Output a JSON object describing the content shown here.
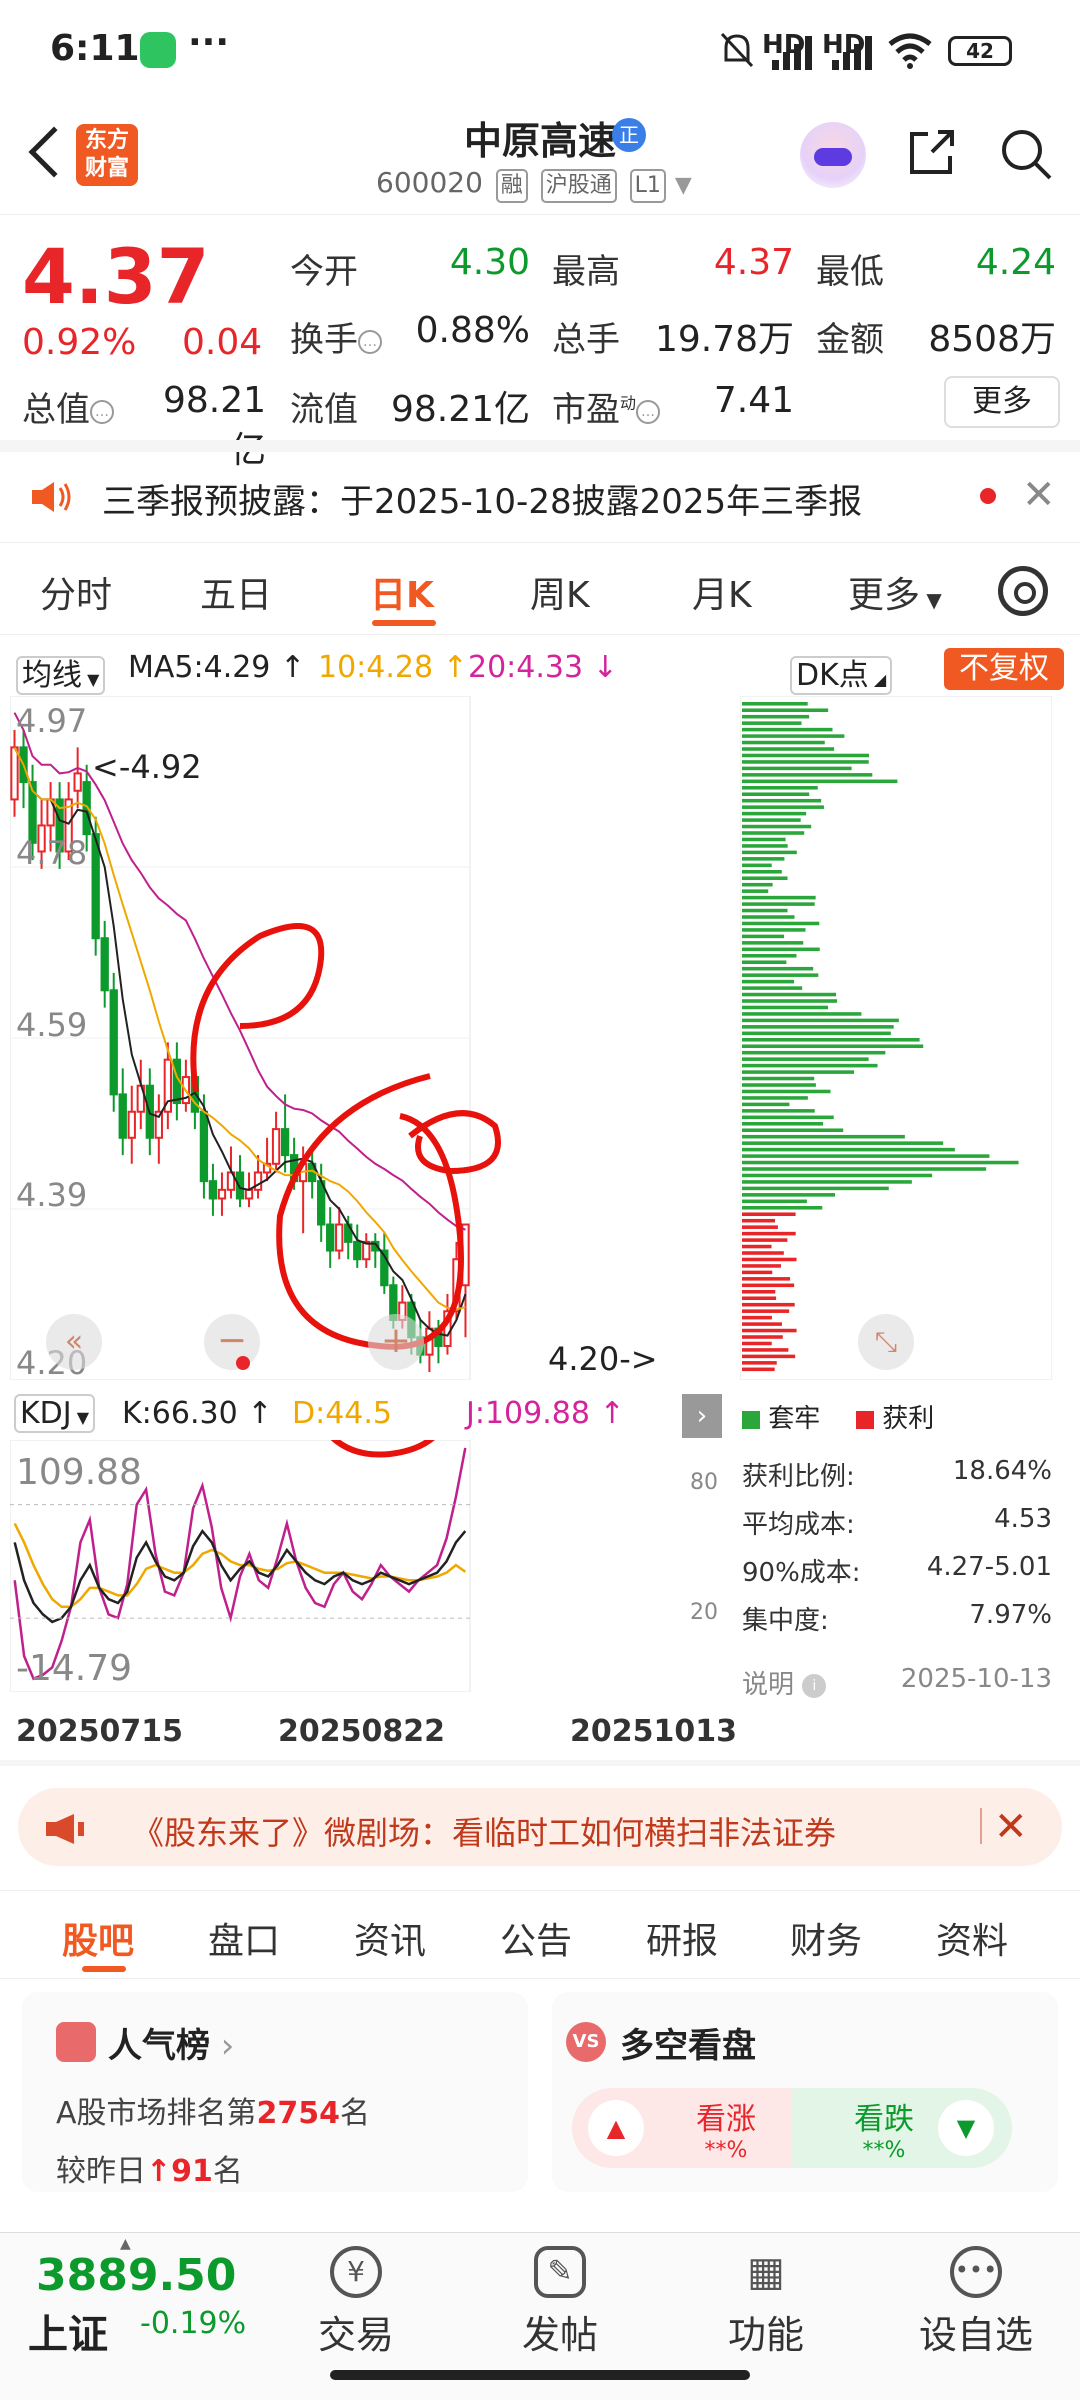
{
  "status_bar": {
    "time": "6:11",
    "dots": "···",
    "signal1": "HD",
    "signal2": "HD",
    "battery": "42"
  },
  "header": {
    "back_icon": "chevron-left-icon",
    "brand": "东方财富",
    "stock_name": "中原高速",
    "badge": "正",
    "code": "600020",
    "tags": [
      "融",
      "沪股通",
      "L1"
    ]
  },
  "quote": {
    "price": "4.37",
    "change_pct": "0.92%",
    "change_amt": "0.04",
    "open_label": "今开",
    "open": "4.30",
    "high_label": "最高",
    "high": "4.37",
    "low_label": "最低",
    "low": "4.24",
    "turnover_label": "换手",
    "turnover": "0.88%",
    "volume_label": "总手",
    "volume": "19.78万",
    "amount_label": "金额",
    "amount": "8508万",
    "mktcap_label": "总值",
    "mktcap": "98.21亿",
    "float_label": "流值",
    "float": "98.21亿",
    "pe_label": "市盈",
    "pe_sup": "动",
    "pe": "7.41",
    "more": "更多"
  },
  "notice": {
    "text": "三季报预披露：于2025-10-28披露2025年三季报"
  },
  "tabs": [
    "分时",
    "五日",
    "日K",
    "周K",
    "月K",
    "更多"
  ],
  "chart_header": {
    "ma_select": "均线",
    "ma5": "MA5:4.29",
    "ma10": "10:4.28",
    "ma20": "20:4.33",
    "dk": "DK点",
    "adjust": "不复权"
  },
  "price_axis": [
    "4.97",
    "4.78",
    "4.59",
    "4.39",
    "4.20"
  ],
  "annotations": {
    "high_mark": "<-4.92",
    "low_mark": "4.20->"
  },
  "kdj": {
    "select": "KDJ",
    "k": "K:66.30",
    "d": "D:44.5",
    "j": "J:109.88",
    "top": "109.88",
    "bottom": "-14.79",
    "lv80": "80",
    "lv20": "20"
  },
  "dates": [
    "20250715",
    "20250822",
    "20251013"
  ],
  "cost_dist": {
    "legend_loss": "套牢",
    "legend_profit": "获利",
    "profit_ratio_label": "获利比例:",
    "profit_ratio": "18.64%",
    "avg_cost_label": "平均成本:",
    "avg_cost": "4.53",
    "cost90_label": "90%成本:",
    "cost90": "4.27-5.01",
    "concentration_label": "集中度:",
    "concentration": "7.97%",
    "note": "说明",
    "date": "2025-10-13"
  },
  "promo": {
    "text": "《股东来了》微剧场：看临时工如何横扫非法证券"
  },
  "bottom_tabs": [
    "股吧",
    "盘口",
    "资讯",
    "公告",
    "研报",
    "财务",
    "资料"
  ],
  "cards": {
    "popularity": {
      "title": "人气榜",
      "rank_prefix": "A股市场排名第",
      "rank": "2754",
      "rank_suffix": "名",
      "delta_prefix": "较昨日",
      "delta": "91",
      "delta_suffix": "名"
    },
    "sentiment": {
      "title": "多空看盘",
      "up": "看涨",
      "up_pct": "**%",
      "down": "看跌",
      "down_pct": "**%"
    }
  },
  "bottom_nav": {
    "index_value": "3889.50",
    "index_name": "上证",
    "index_change": "-0.19%",
    "items": [
      "交易",
      "发帖",
      "功能",
      "设自选"
    ]
  },
  "chart_data": {
    "type": "candlestick",
    "candles": [
      [
        4.86,
        4.92,
        4.94,
        4.84
      ],
      [
        4.92,
        4.88,
        4.94,
        4.85
      ],
      [
        4.88,
        4.81,
        4.9,
        4.79
      ],
      [
        4.8,
        4.83,
        4.86,
        4.78
      ],
      [
        4.83,
        4.86,
        4.88,
        4.8
      ],
      [
        4.86,
        4.8,
        4.88,
        4.78
      ],
      [
        4.8,
        4.86,
        4.88,
        4.79
      ],
      [
        4.87,
        4.89,
        4.92,
        4.85
      ],
      [
        4.88,
        4.82,
        4.9,
        4.8
      ],
      [
        4.82,
        4.7,
        4.84,
        4.68
      ],
      [
        4.7,
        4.64,
        4.72,
        4.62
      ],
      [
        4.64,
        4.52,
        4.66,
        4.5
      ],
      [
        4.52,
        4.47,
        4.55,
        4.45
      ],
      [
        4.47,
        4.5,
        4.53,
        4.44
      ],
      [
        4.5,
        4.53,
        4.56,
        4.48
      ],
      [
        4.53,
        4.47,
        4.55,
        4.45
      ],
      [
        4.47,
        4.5,
        4.52,
        4.44
      ],
      [
        4.5,
        4.56,
        4.58,
        4.48
      ],
      [
        4.56,
        4.51,
        4.58,
        4.49
      ],
      [
        4.51,
        4.54,
        4.56,
        4.5
      ],
      [
        4.54,
        4.5,
        4.56,
        4.48
      ],
      [
        4.5,
        4.42,
        4.52,
        4.4
      ],
      [
        4.42,
        4.4,
        4.44,
        4.38
      ],
      [
        4.4,
        4.41,
        4.43,
        4.38
      ],
      [
        4.41,
        4.43,
        4.46,
        4.4
      ],
      [
        4.43,
        4.4,
        4.45,
        4.39
      ],
      [
        4.4,
        4.41,
        4.43,
        4.39
      ],
      [
        4.41,
        4.43,
        4.45,
        4.4
      ],
      [
        4.43,
        4.44,
        4.47,
        4.42
      ],
      [
        4.44,
        4.48,
        4.5,
        4.43
      ],
      [
        4.48,
        4.45,
        4.52,
        4.43
      ],
      [
        4.45,
        4.42,
        4.47,
        4.41
      ],
      [
        4.42,
        4.44,
        4.46,
        4.36
      ],
      [
        4.44,
        4.42,
        4.46,
        4.4
      ],
      [
        4.42,
        4.37,
        4.44,
        4.35
      ],
      [
        4.37,
        4.34,
        4.39,
        4.32
      ],
      [
        4.34,
        4.37,
        4.39,
        4.33
      ],
      [
        4.37,
        4.35,
        4.38,
        4.33
      ],
      [
        4.35,
        4.33,
        4.37,
        4.32
      ],
      [
        4.33,
        4.35,
        4.36,
        4.32
      ],
      [
        4.35,
        4.34,
        4.36,
        4.32
      ],
      [
        4.34,
        4.3,
        4.36,
        4.29
      ],
      [
        4.3,
        4.26,
        4.31,
        4.25
      ],
      [
        4.26,
        4.28,
        4.3,
        4.25
      ],
      [
        4.28,
        4.24,
        4.29,
        4.22
      ],
      [
        4.24,
        4.22,
        4.26,
        4.21
      ],
      [
        4.22,
        4.25,
        4.27,
        4.2
      ],
      [
        4.25,
        4.23,
        4.26,
        4.21
      ],
      [
        4.23,
        4.27,
        4.29,
        4.22
      ],
      [
        4.27,
        4.33,
        4.35,
        4.26
      ],
      [
        4.3,
        4.37,
        4.37,
        4.24
      ]
    ],
    "ma5_latest": 4.29,
    "ma10_latest": 4.28,
    "ma20_latest": 4.33,
    "y_range": [
      4.2,
      4.97
    ],
    "kdj": {
      "k": 66.3,
      "d": 44.5,
      "j": 109.88,
      "range": [
        -14.79,
        109.88
      ]
    }
  }
}
